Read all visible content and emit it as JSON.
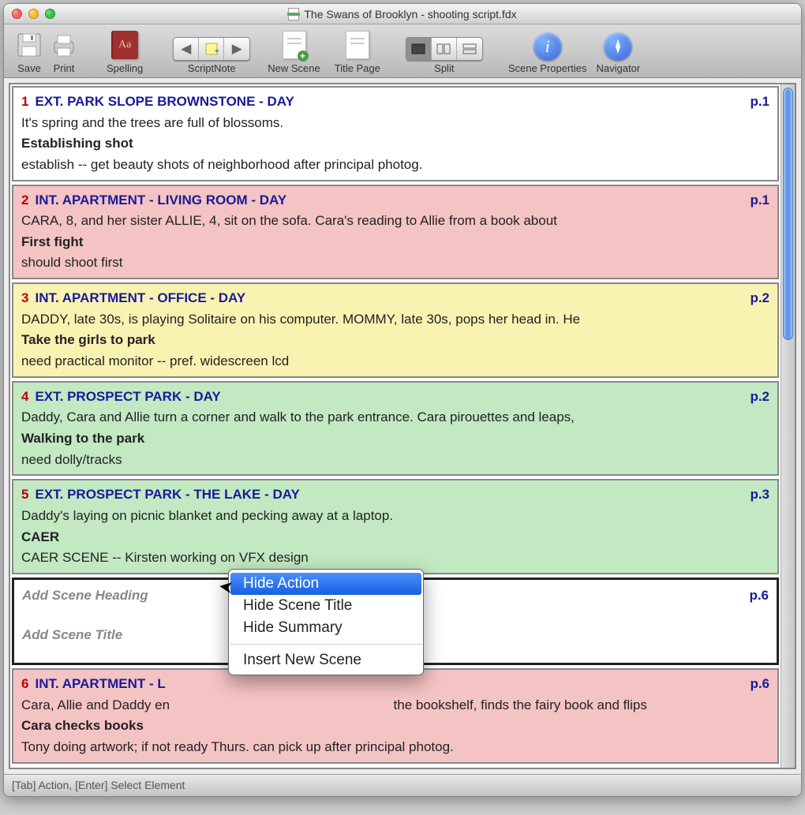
{
  "window": {
    "title": "The Swans of Brooklyn - shooting script.fdx"
  },
  "toolbar": {
    "save": "Save",
    "print": "Print",
    "spelling": "Spelling",
    "scriptnote": "ScriptNote",
    "newscene": "New Scene",
    "titlepage": "Title Page",
    "split": "Split",
    "sceneprops": "Scene Properties",
    "navigator": "Navigator"
  },
  "scenes": [
    {
      "num": "1",
      "heading": "EXT. PARK SLOPE BROWNSTONE - DAY",
      "page": "p.1",
      "action": "It's spring and the trees are full of blossoms.",
      "title": "Establishing shot",
      "note": "establish -- get beauty shots of neighborhood after principal photog.",
      "bg": "bg-white"
    },
    {
      "num": "2",
      "heading": "INT. APARTMENT - LIVING ROOM - DAY",
      "page": "p.1",
      "action": "CARA, 8, and her sister ALLIE, 4, sit on the sofa.  Cara's reading to Allie from a book about",
      "title": "First fight",
      "note": "should shoot first",
      "bg": "bg-pink"
    },
    {
      "num": "3",
      "heading": "INT. APARTMENT - OFFICE - DAY",
      "page": "p.2",
      "action": "DADDY, late 30s, is playing Solitaire on his computer.  MOMMY, late 30s, pops her head in.  He",
      "title": "Take the girls to park",
      "note": "need practical monitor -- pref. widescreen lcd",
      "bg": "bg-yellow"
    },
    {
      "num": "4",
      "heading": "EXT. PROSPECT PARK - DAY",
      "page": "p.2",
      "action": "Daddy, Cara and Allie turn a corner and walk to the park entrance.  Cara pirouettes and leaps,",
      "title": "Walking to the park",
      "note": "need dolly/tracks",
      "bg": "bg-green"
    },
    {
      "num": "5",
      "heading": "EXT. PROSPECT PARK - THE LAKE - DAY",
      "page": "p.3",
      "action": "Daddy's laying on picnic blanket and pecking away at a laptop.",
      "title": "CAER",
      "note": "CAER SCENE -- Kirsten working on VFX design",
      "bg": "bg-green"
    }
  ],
  "empty_scene": {
    "heading_placeholder": "Add Scene Heading",
    "title_placeholder": "Add Scene Title",
    "page": "p.6"
  },
  "scene6": {
    "num": "6",
    "heading": "INT. APARTMENT - L",
    "page": "p.6",
    "action_pre": "Cara, Allie and Daddy en",
    "action_post": "the bookshelf, finds the fairy book and flips",
    "title": "Cara checks books",
    "note": "Tony doing artwork; if not ready Thurs. can pick up after principal photog."
  },
  "context_menu": {
    "items": [
      "Hide Action",
      "Hide Scene Title",
      "Hide Summary",
      "Insert New Scene"
    ],
    "highlighted": 0
  },
  "status_bar": "[Tab]  Action,  [Enter] Select Element"
}
